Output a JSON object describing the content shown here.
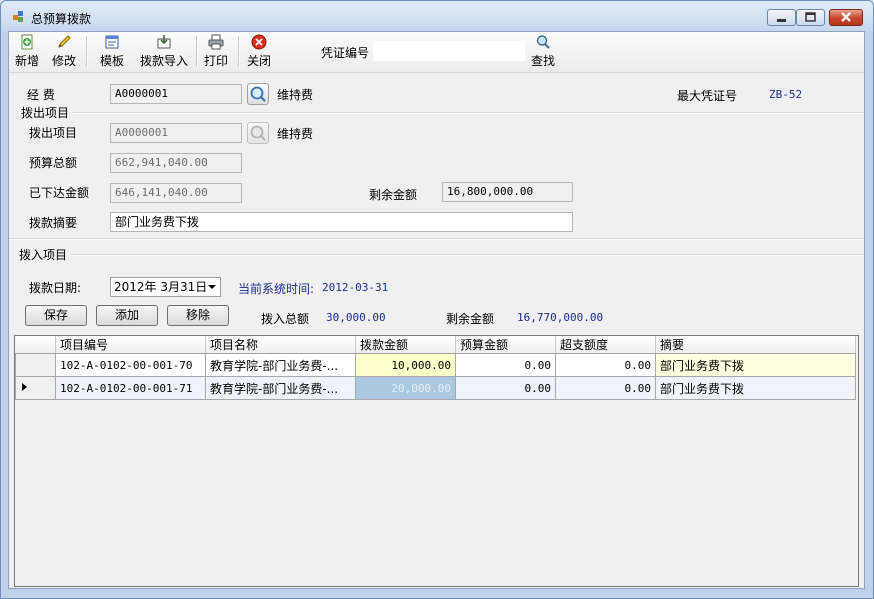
{
  "window": {
    "title": "总预算拨款"
  },
  "toolbar": {
    "new_label": "新增",
    "edit_label": "修改",
    "template_label": "模板",
    "import_label": "拨款导入",
    "print_label": "打印",
    "close_label": "关闭",
    "voucher_label": "凭证编号",
    "voucher_value": "",
    "search_label": "查找"
  },
  "header": {
    "fund_label": "经      费",
    "fund_code": "A0000001",
    "fund_name": "维持费",
    "max_voucher_label": "最大凭证号",
    "max_voucher_value": "ZB-52"
  },
  "out_section": {
    "title": "拨出项目",
    "item_label": "拨出项目",
    "item_code": "A0000001",
    "item_name": "维持费",
    "budget_total_label": "预算总额",
    "budget_total_value": "662,941,040.00",
    "issued_label": "已下达金额",
    "issued_value": "646,141,040.00",
    "remaining_label": "剩余金额",
    "remaining_value": "16,800,000.00",
    "summary_label": "拨款摘要",
    "summary_value": "部门业务费下拨"
  },
  "in_section": {
    "title": "拨入项目",
    "date_label": "拨款日期:",
    "date_value": "2012年  3月31日",
    "sys_time_label": "当前系统时间:",
    "sys_time_value": "2012-03-31",
    "save_label": "保存",
    "add_label": "添加",
    "remove_label": "移除",
    "in_total_label": "拨入总额",
    "in_total_value": "30,000.00",
    "remaining_label": "剩余金额",
    "remaining_value": "16,770,000.00"
  },
  "grid": {
    "columns": [
      "项目编号",
      "项目名称",
      "拨款金额",
      "预算金额",
      "超支额度",
      "摘要"
    ],
    "rows": [
      {
        "code": "102-A-0102-00-001-70",
        "name": "教育学院-部门业务费-...",
        "amount": "10,000.00",
        "budget": "0.00",
        "over": "0.00",
        "summary": "部门业务费下拨",
        "current": false
      },
      {
        "code": "102-A-0102-00-001-71",
        "name": "教育学院-部门业务费-...",
        "amount": "20,000.00",
        "budget": "0.00",
        "over": "0.00",
        "summary": "部门业务费下拨",
        "current": true
      }
    ]
  },
  "colors": {
    "label_blue": "#1c2e8c",
    "selected_cell": "#aac8e0",
    "edit_row": "#ffffe1"
  }
}
